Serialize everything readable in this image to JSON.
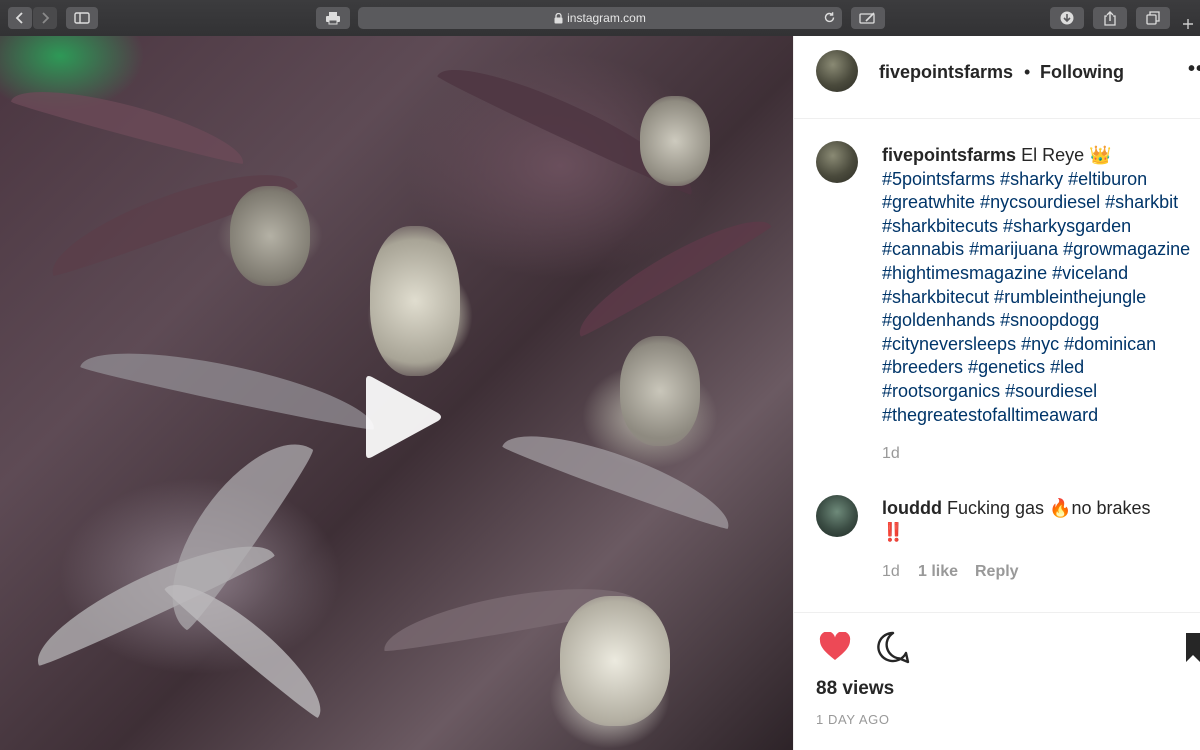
{
  "browser": {
    "url": "instagram.com"
  },
  "post": {
    "username": "fivepointsfarms",
    "follow_status": "Following",
    "separator": "•",
    "more": "••",
    "caption_title": "El Reye 👑",
    "caption_lines": [
      "#5pointsfarms #sharky #eltiburon",
      "#greatwhite #nycsourdiesel #sharkbit",
      "#sharkbitecuts #sharkysgarden",
      "#cannabis #marijuana #growmagazine",
      "#hightimesmagazine #viceland",
      "#sharkbitecut #rumbleinthejungle",
      "#goldenhands #snoopdogg",
      "#cityneversleeps #nyc #dominican",
      "#breeders #genetics #led",
      "#rootsorganics #sourdiesel",
      "#thegreatestofalltimeaward"
    ],
    "caption_age": "1d",
    "comment": {
      "username": "louddd",
      "text": "Fucking gas 🔥no brakes",
      "text2": "‼️",
      "age": "1d",
      "likes": "1 like",
      "reply": "Reply"
    },
    "views": "88 views",
    "posted": "1 DAY AGO",
    "colors": {
      "like": "#ed4956",
      "hashtag": "#003569"
    }
  }
}
